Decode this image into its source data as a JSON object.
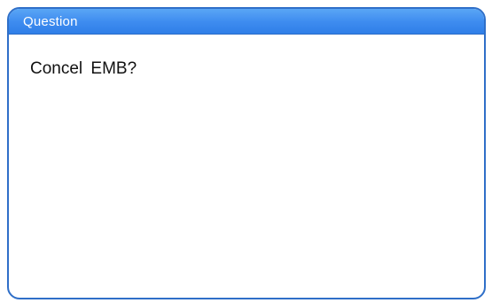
{
  "dialog": {
    "title": "Question",
    "message": "Concel EMB?"
  },
  "colors": {
    "titlebar": "#3f8df0",
    "border": "#2f6fc8",
    "title_text": "#ffffff",
    "message_text": "#111111"
  }
}
